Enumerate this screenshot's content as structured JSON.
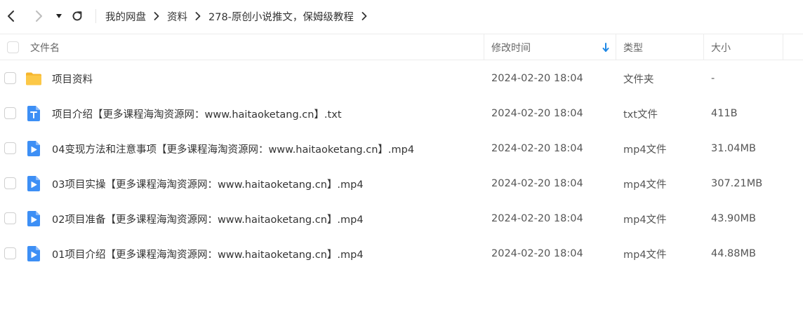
{
  "toolbar": {
    "back_icon": "chevron-left-icon",
    "forward_icon": "chevron-right-icon",
    "history_icon": "caret-down-icon",
    "refresh_icon": "refresh-icon"
  },
  "breadcrumb": [
    "我的网盘",
    "资料",
    "278-原创小说推文，保姆级教程"
  ],
  "columns": {
    "name": "文件名",
    "modified": "修改时间",
    "type": "类型",
    "size": "大小",
    "sort_icon": "arrow-down-icon",
    "sort_color": "#1e88e5"
  },
  "colors": {
    "folder": "#fbc23b",
    "txt_icon": "#3d8ff5",
    "video_icon": "#3d8ff5"
  },
  "files": [
    {
      "icon": "folder-icon",
      "name": "项目资料",
      "modified": "2024-02-20 18:04",
      "type": "文件夹",
      "size": "-"
    },
    {
      "icon": "txt-file-icon",
      "name": "项目介绍【更多课程海淘资源网：www.haitaoketang.cn】.txt",
      "modified": "2024-02-20 18:04",
      "type": "txt文件",
      "size": "411B"
    },
    {
      "icon": "video-file-icon",
      "name": "04变现方法和注意事项【更多课程海淘资源网：www.haitaoketang.cn】.mp4",
      "modified": "2024-02-20 18:04",
      "type": "mp4文件",
      "size": "31.04MB"
    },
    {
      "icon": "video-file-icon",
      "name": "03项目实操【更多课程海淘资源网：www.haitaoketang.cn】.mp4",
      "modified": "2024-02-20 18:04",
      "type": "mp4文件",
      "size": "307.21MB"
    },
    {
      "icon": "video-file-icon",
      "name": "02项目准备【更多课程海淘资源网：www.haitaoketang.cn】.mp4",
      "modified": "2024-02-20 18:04",
      "type": "mp4文件",
      "size": "43.90MB"
    },
    {
      "icon": "video-file-icon",
      "name": "01项目介绍【更多课程海淘资源网：www.haitaoketang.cn】.mp4",
      "modified": "2024-02-20 18:04",
      "type": "mp4文件",
      "size": "44.88MB"
    }
  ]
}
